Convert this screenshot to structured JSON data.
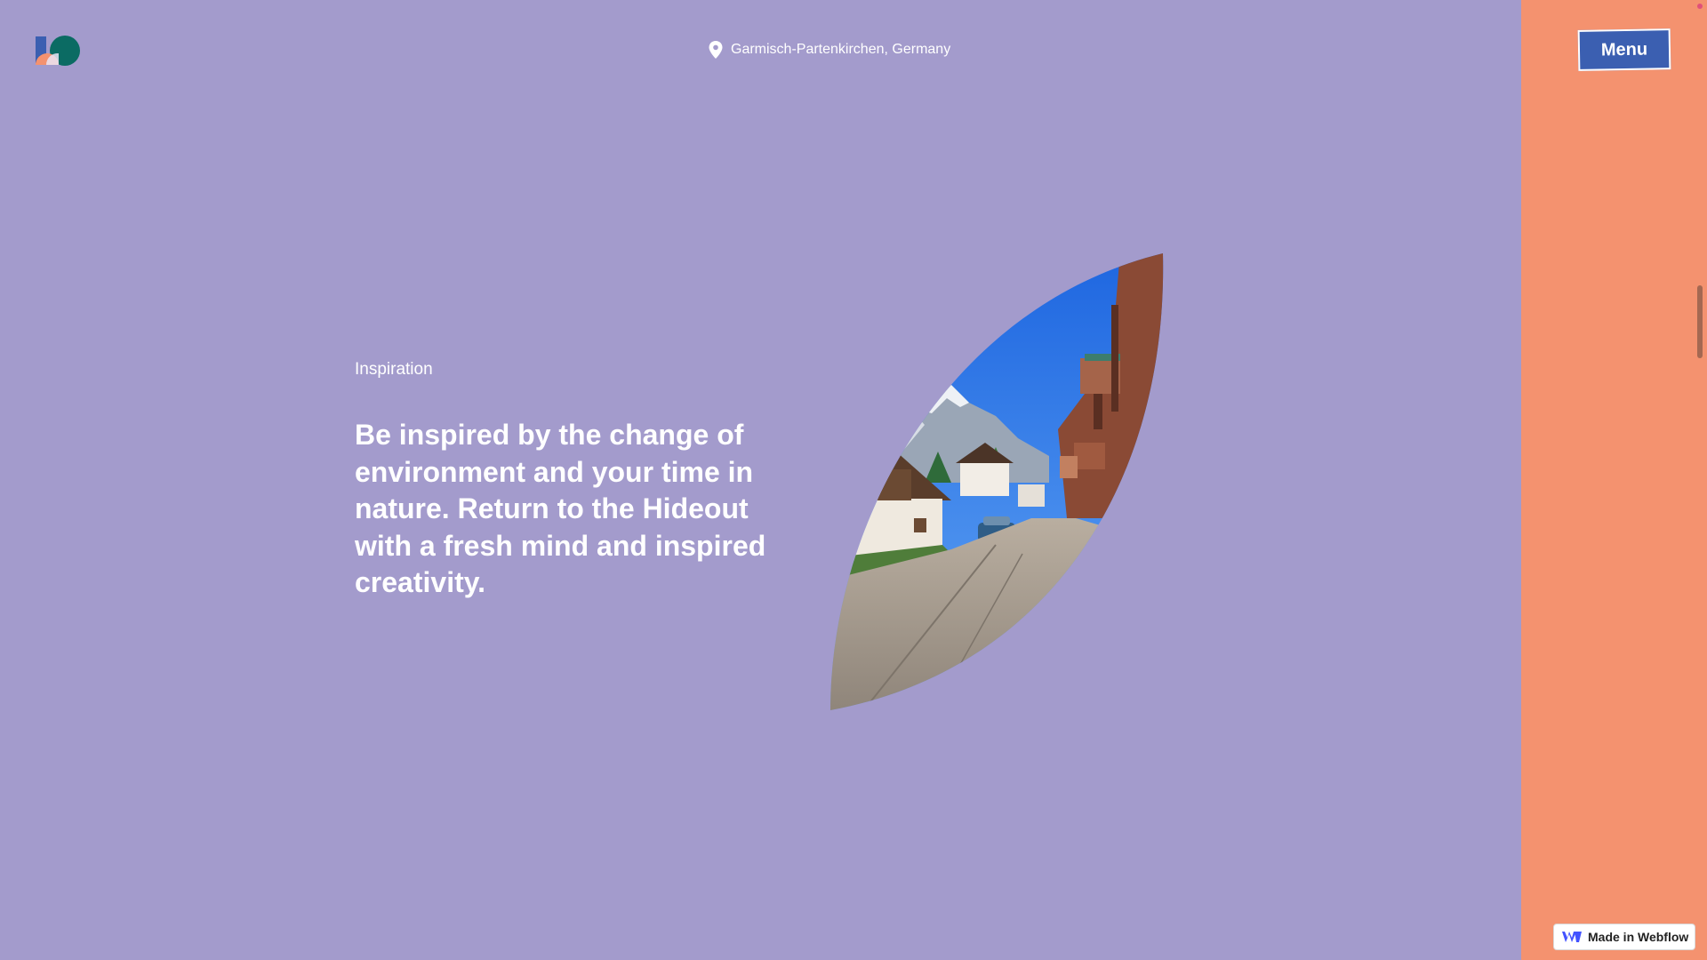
{
  "header": {
    "location": "Garmisch-Partenkirchen, Germany",
    "menu_label": "Menu"
  },
  "main": {
    "eyebrow": "Inspiration",
    "headline": "Be inspired by the change of environment and your time in nature. Return to the Hideout with a fresh mind and inspired creativity."
  },
  "badge": {
    "label": "Made in Webflow"
  },
  "icons": {
    "logo": "hideout-logo",
    "location": "map-pin-icon",
    "badge": "webflow-logo-icon"
  },
  "colors": {
    "background": "#a39bcc",
    "side_panel": "#f4926f",
    "menu_button": "#3b5fb1",
    "text": "#ffffff",
    "logo_blue": "#3b5fb1",
    "logo_teal": "#0b6b63",
    "logo_peach": "#f4926f"
  }
}
